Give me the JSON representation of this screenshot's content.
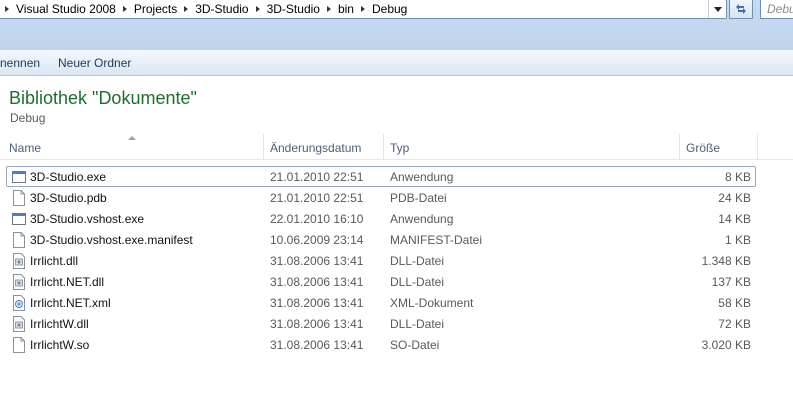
{
  "address": {
    "crumbs": [
      "Visual Studio 2008",
      "Projects",
      "3D-Studio",
      "3D-Studio",
      "bin",
      "Debug"
    ],
    "search_placeholder": "Debug"
  },
  "toolbar": {
    "rename_label": "nennen",
    "new_folder_label": "Neuer Ordner"
  },
  "library": {
    "title": "Bibliothek \"Dokumente\"",
    "subtitle": "Debug"
  },
  "columns": {
    "name": "Name",
    "date": "Änderungsdatum",
    "type": "Typ",
    "size": "Größe"
  },
  "files": [
    {
      "name": "3D-Studio.exe",
      "date": "21.01.2010 22:51",
      "type": "Anwendung",
      "size": "8 KB",
      "icon": "exe-icon"
    },
    {
      "name": "3D-Studio.pdb",
      "date": "21.01.2010 22:51",
      "type": "PDB-Datei",
      "size": "24 KB",
      "icon": "file-icon"
    },
    {
      "name": "3D-Studio.vshost.exe",
      "date": "22.01.2010 16:10",
      "type": "Anwendung",
      "size": "14 KB",
      "icon": "exe-icon"
    },
    {
      "name": "3D-Studio.vshost.exe.manifest",
      "date": "10.06.2009 23:14",
      "type": "MANIFEST-Datei",
      "size": "1 KB",
      "icon": "file-icon"
    },
    {
      "name": "Irrlicht.dll",
      "date": "31.08.2006 13:41",
      "type": "DLL-Datei",
      "size": "1.348 KB",
      "icon": "dll-icon"
    },
    {
      "name": "Irrlicht.NET.dll",
      "date": "31.08.2006 13:41",
      "type": "DLL-Datei",
      "size": "137 KB",
      "icon": "dll-icon"
    },
    {
      "name": "Irrlicht.NET.xml",
      "date": "31.08.2006 13:41",
      "type": "XML-Dokument",
      "size": "58 KB",
      "icon": "xml-icon"
    },
    {
      "name": "IrrlichtW.dll",
      "date": "31.08.2006 13:41",
      "type": "DLL-Datei",
      "size": "72 KB",
      "icon": "dll-icon"
    },
    {
      "name": "IrrlichtW.so",
      "date": "31.08.2006 13:41",
      "type": "SO-Datei",
      "size": "3.020 KB",
      "icon": "file-icon"
    }
  ],
  "colors": {
    "library_title": "#1e6e2c",
    "header_text": "#4c607a",
    "toolbar_text": "#1e395b"
  }
}
